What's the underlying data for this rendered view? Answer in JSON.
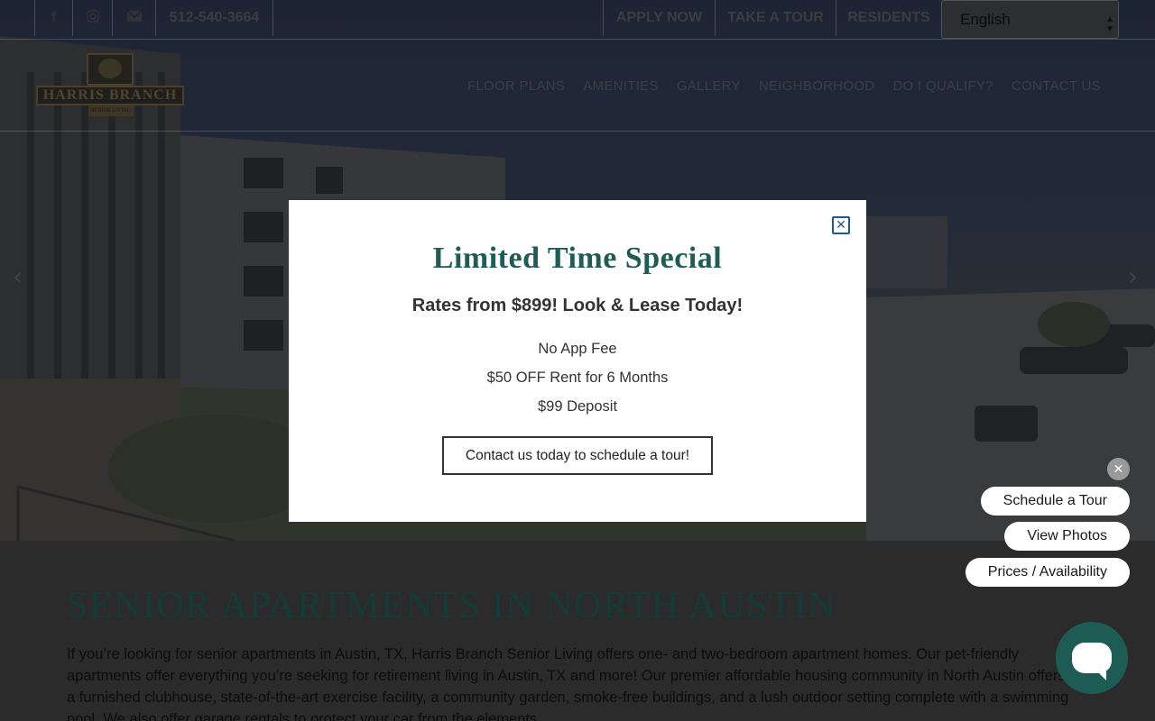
{
  "topbar": {
    "social_icons": [
      "facebook-icon",
      "instagram-icon",
      "email-icon"
    ],
    "phone": "512-540-3664",
    "links": [
      "APPLY NOW",
      "TAKE A TOUR",
      "RESIDENTS"
    ],
    "language": "English"
  },
  "logo": {
    "name": "HARRIS BRANCH",
    "tagline": "SENIOR LIVING"
  },
  "nav": {
    "items": [
      "FLOOR PLANS",
      "AMENITIES",
      "GALLERY",
      "NEIGHBORHOOD",
      "DO I QUALIFY?",
      "CONTACT US"
    ]
  },
  "hero": {
    "prev_glyph": "‹",
    "next_glyph": "›"
  },
  "content": {
    "heading": "SENIOR APARTMENTS IN NORTH AUSTIN",
    "paragraph": "If you’re looking for senior apartments in Austin, TX, Harris Branch Senior Living offers one- and two-bedroom apartment homes. Our pet-friendly apartments offer everything you’re seeking for retirement living in Austin, TX and more! Our premier affordable housing community in North Austin offers a furnished clubhouse, state-of-the-art exercise facility, a community garden, smoke-free buildings, and a lush outdoor setting complete with a swimming pool. We also offer garage rentals to protect your car from the elements."
  },
  "modal": {
    "title": "Limited Time Special",
    "subtitle": "Rates from $899! Look & Lease Today!",
    "offers": [
      "No App Fee",
      "$50 OFF Rent for 6 Months",
      "$99 Deposit"
    ],
    "cta": "Contact us today to schedule a tour!",
    "close_glyph": "✕"
  },
  "widgets": {
    "close_glyph": "✕",
    "buttons": [
      "Schedule a Tour",
      "View Photos",
      "Prices / Availability"
    ]
  },
  "colors": {
    "brand_green": "#1e5c55",
    "chat_button": "#1c5c54",
    "modal_bg": "#ffffff",
    "close_blue": "#1f5a8f"
  }
}
